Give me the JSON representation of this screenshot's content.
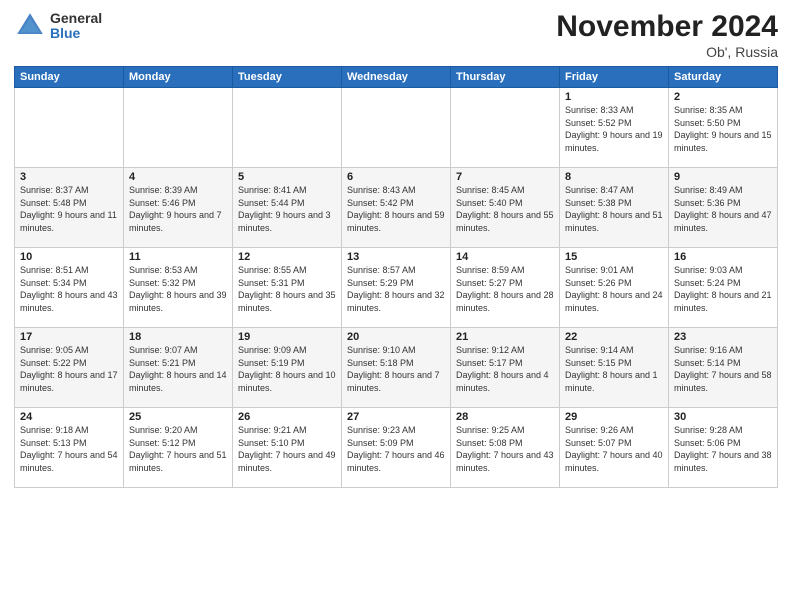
{
  "logo": {
    "general": "General",
    "blue": "Blue"
  },
  "title": "November 2024",
  "location": "Ob', Russia",
  "days_of_week": [
    "Sunday",
    "Monday",
    "Tuesday",
    "Wednesday",
    "Thursday",
    "Friday",
    "Saturday"
  ],
  "weeks": [
    [
      {
        "day": "",
        "info": ""
      },
      {
        "day": "",
        "info": ""
      },
      {
        "day": "",
        "info": ""
      },
      {
        "day": "",
        "info": ""
      },
      {
        "day": "",
        "info": ""
      },
      {
        "day": "1",
        "info": "Sunrise: 8:33 AM\nSunset: 5:52 PM\nDaylight: 9 hours and 19 minutes."
      },
      {
        "day": "2",
        "info": "Sunrise: 8:35 AM\nSunset: 5:50 PM\nDaylight: 9 hours and 15 minutes."
      }
    ],
    [
      {
        "day": "3",
        "info": "Sunrise: 8:37 AM\nSunset: 5:48 PM\nDaylight: 9 hours and 11 minutes."
      },
      {
        "day": "4",
        "info": "Sunrise: 8:39 AM\nSunset: 5:46 PM\nDaylight: 9 hours and 7 minutes."
      },
      {
        "day": "5",
        "info": "Sunrise: 8:41 AM\nSunset: 5:44 PM\nDaylight: 9 hours and 3 minutes."
      },
      {
        "day": "6",
        "info": "Sunrise: 8:43 AM\nSunset: 5:42 PM\nDaylight: 8 hours and 59 minutes."
      },
      {
        "day": "7",
        "info": "Sunrise: 8:45 AM\nSunset: 5:40 PM\nDaylight: 8 hours and 55 minutes."
      },
      {
        "day": "8",
        "info": "Sunrise: 8:47 AM\nSunset: 5:38 PM\nDaylight: 8 hours and 51 minutes."
      },
      {
        "day": "9",
        "info": "Sunrise: 8:49 AM\nSunset: 5:36 PM\nDaylight: 8 hours and 47 minutes."
      }
    ],
    [
      {
        "day": "10",
        "info": "Sunrise: 8:51 AM\nSunset: 5:34 PM\nDaylight: 8 hours and 43 minutes."
      },
      {
        "day": "11",
        "info": "Sunrise: 8:53 AM\nSunset: 5:32 PM\nDaylight: 8 hours and 39 minutes."
      },
      {
        "day": "12",
        "info": "Sunrise: 8:55 AM\nSunset: 5:31 PM\nDaylight: 8 hours and 35 minutes."
      },
      {
        "day": "13",
        "info": "Sunrise: 8:57 AM\nSunset: 5:29 PM\nDaylight: 8 hours and 32 minutes."
      },
      {
        "day": "14",
        "info": "Sunrise: 8:59 AM\nSunset: 5:27 PM\nDaylight: 8 hours and 28 minutes."
      },
      {
        "day": "15",
        "info": "Sunrise: 9:01 AM\nSunset: 5:26 PM\nDaylight: 8 hours and 24 minutes."
      },
      {
        "day": "16",
        "info": "Sunrise: 9:03 AM\nSunset: 5:24 PM\nDaylight: 8 hours and 21 minutes."
      }
    ],
    [
      {
        "day": "17",
        "info": "Sunrise: 9:05 AM\nSunset: 5:22 PM\nDaylight: 8 hours and 17 minutes."
      },
      {
        "day": "18",
        "info": "Sunrise: 9:07 AM\nSunset: 5:21 PM\nDaylight: 8 hours and 14 minutes."
      },
      {
        "day": "19",
        "info": "Sunrise: 9:09 AM\nSunset: 5:19 PM\nDaylight: 8 hours and 10 minutes."
      },
      {
        "day": "20",
        "info": "Sunrise: 9:10 AM\nSunset: 5:18 PM\nDaylight: 8 hours and 7 minutes."
      },
      {
        "day": "21",
        "info": "Sunrise: 9:12 AM\nSunset: 5:17 PM\nDaylight: 8 hours and 4 minutes."
      },
      {
        "day": "22",
        "info": "Sunrise: 9:14 AM\nSunset: 5:15 PM\nDaylight: 8 hours and 1 minute."
      },
      {
        "day": "23",
        "info": "Sunrise: 9:16 AM\nSunset: 5:14 PM\nDaylight: 7 hours and 58 minutes."
      }
    ],
    [
      {
        "day": "24",
        "info": "Sunrise: 9:18 AM\nSunset: 5:13 PM\nDaylight: 7 hours and 54 minutes."
      },
      {
        "day": "25",
        "info": "Sunrise: 9:20 AM\nSunset: 5:12 PM\nDaylight: 7 hours and 51 minutes."
      },
      {
        "day": "26",
        "info": "Sunrise: 9:21 AM\nSunset: 5:10 PM\nDaylight: 7 hours and 49 minutes."
      },
      {
        "day": "27",
        "info": "Sunrise: 9:23 AM\nSunset: 5:09 PM\nDaylight: 7 hours and 46 minutes."
      },
      {
        "day": "28",
        "info": "Sunrise: 9:25 AM\nSunset: 5:08 PM\nDaylight: 7 hours and 43 minutes."
      },
      {
        "day": "29",
        "info": "Sunrise: 9:26 AM\nSunset: 5:07 PM\nDaylight: 7 hours and 40 minutes."
      },
      {
        "day": "30",
        "info": "Sunrise: 9:28 AM\nSunset: 5:06 PM\nDaylight: 7 hours and 38 minutes."
      }
    ]
  ]
}
